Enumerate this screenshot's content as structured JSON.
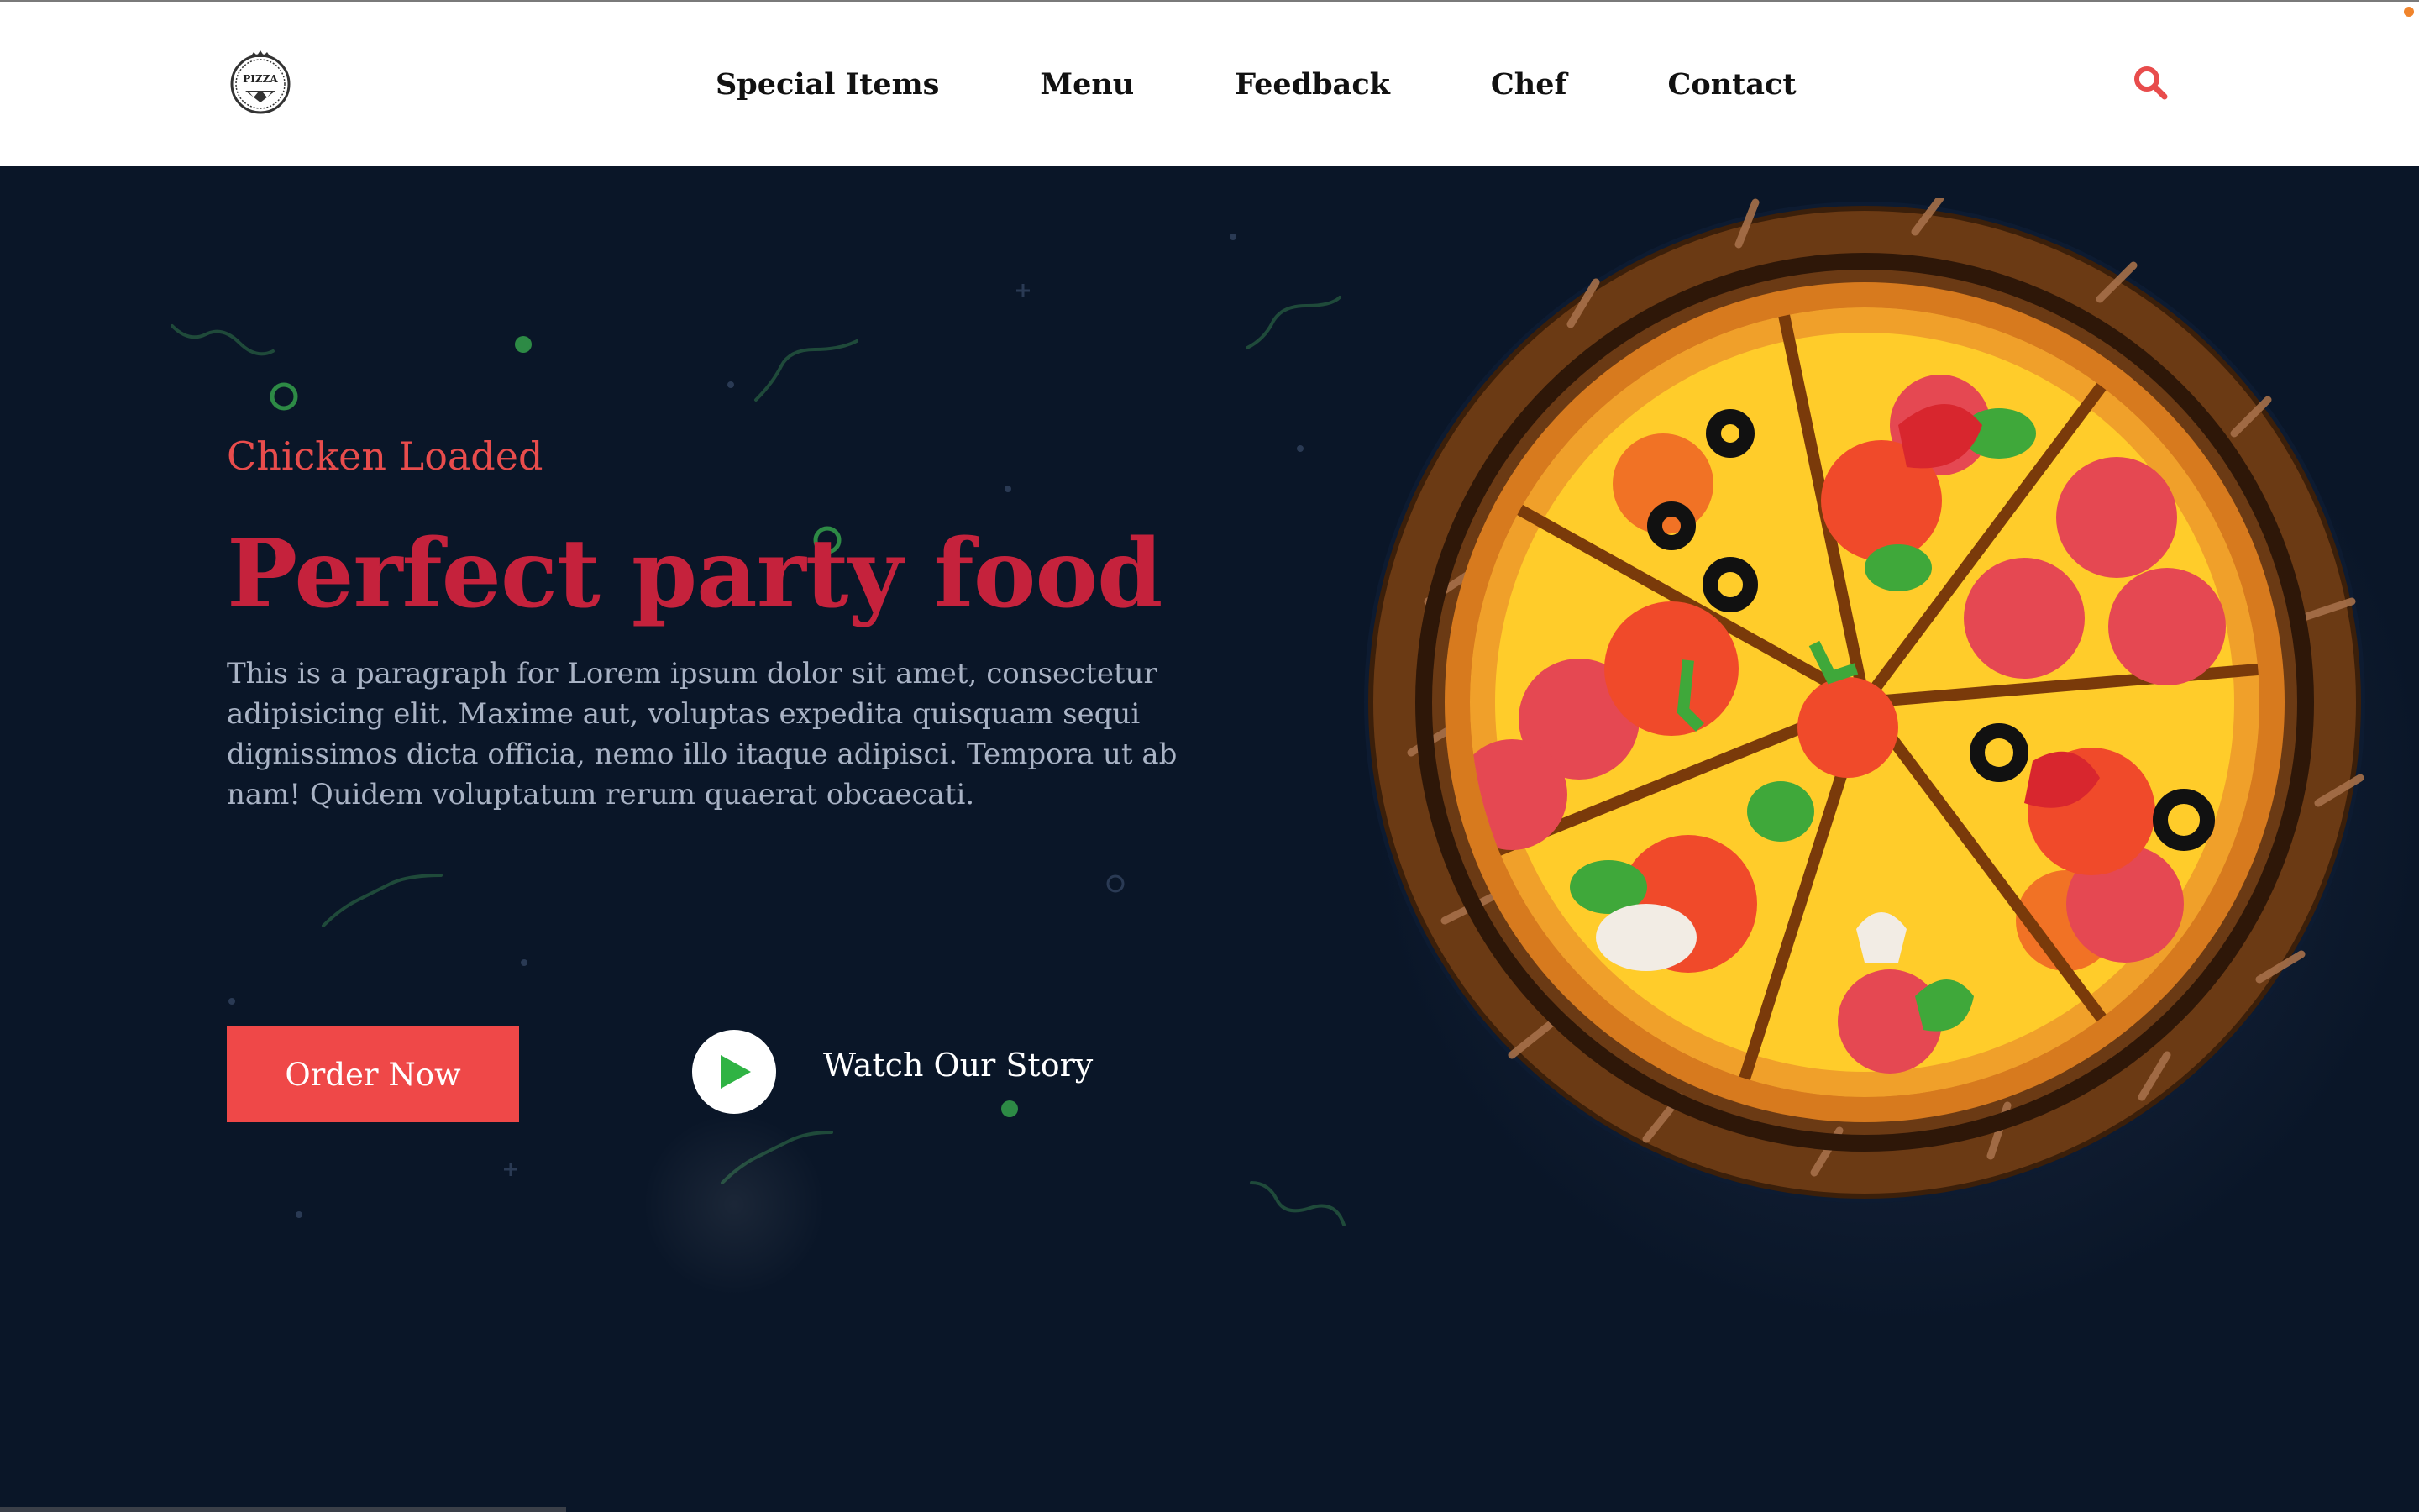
{
  "header": {
    "logo_text": "PIZZA",
    "nav": [
      {
        "label": "Special Items"
      },
      {
        "label": "Menu"
      },
      {
        "label": "Feedback"
      },
      {
        "label": "Chef"
      },
      {
        "label": "Contact"
      }
    ],
    "search_icon": "search-icon"
  },
  "hero": {
    "subtitle": "Chicken Loaded",
    "title": "Perfect party food",
    "paragraph": "This is a paragraph for Lorem ipsum dolor sit amet, consectetur adipisicing elit. Maxime aut, voluptas expedita quisquam sequi dignissimos dicta officia, nemo illo itaque adipisci. Tempora ut ab nam! Quidem voluptatum rerum quaerat obcaecati.",
    "order_button": "Order Now",
    "watch_label": "Watch Our Story",
    "play_icon": "play-icon"
  },
  "colors": {
    "background": "#0a1628",
    "accent": "#ef4848",
    "title": "#c5223c",
    "subtitle": "#e84c4c",
    "paragraph": "#a9b3c5",
    "play": "#2fb344"
  }
}
